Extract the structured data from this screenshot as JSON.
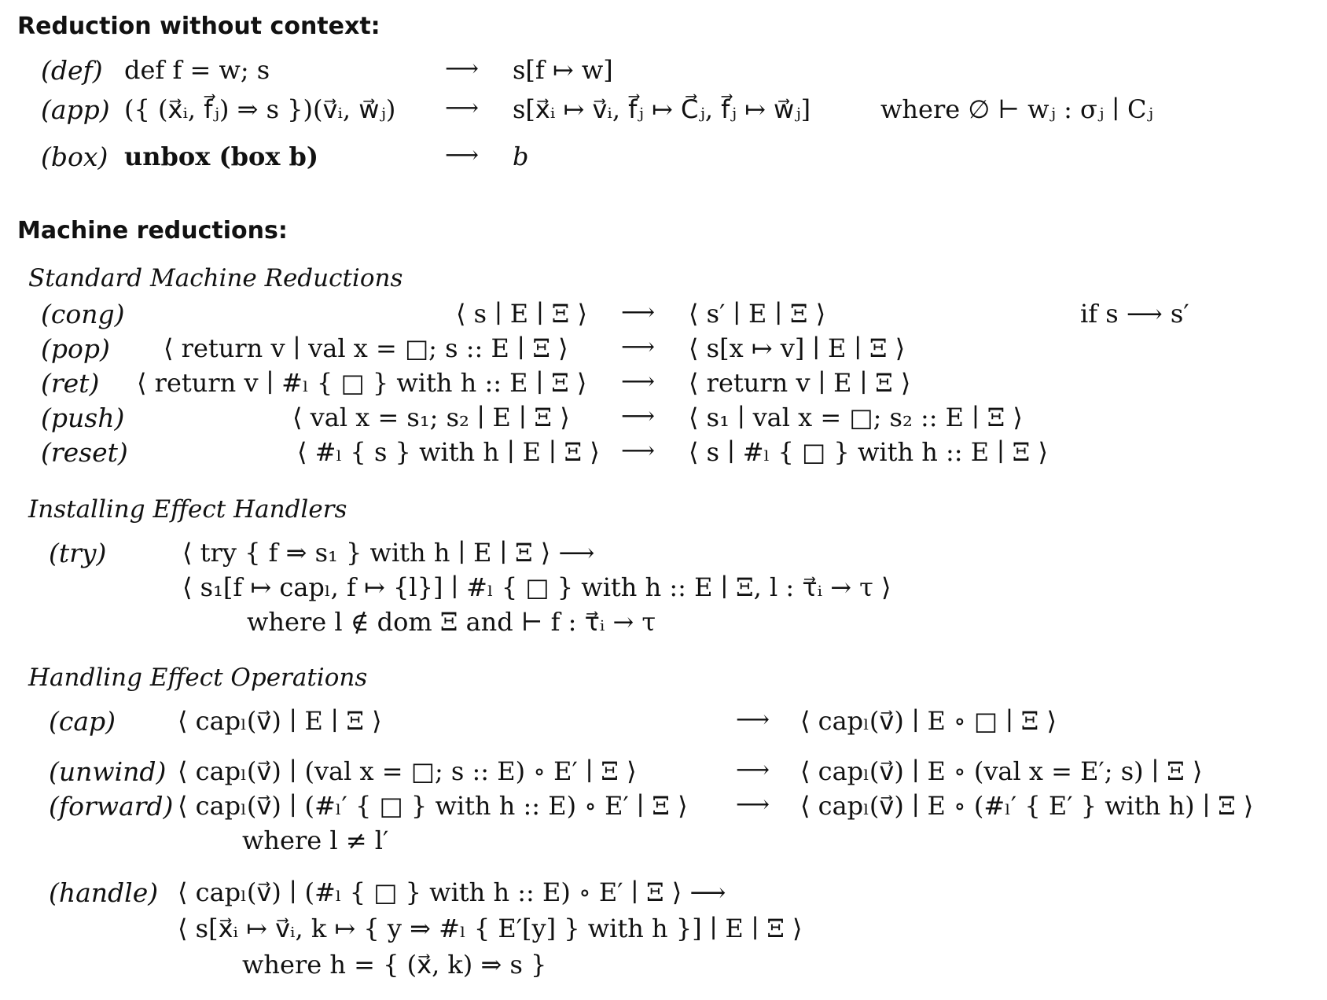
{
  "sections": {
    "without_context": "Reduction without context:",
    "machine": "Machine reductions:",
    "standard": "Standard Machine Reductions",
    "installing": "Installing Effect Handlers",
    "handling": "Handling Effect Operations"
  },
  "ctx_free": [
    {
      "tag": "(def)",
      "lhs": "def f  =  w;  s",
      "arrow": "⟶",
      "rhs": "s[f ↦ w]",
      "side": ""
    },
    {
      "tag": "(app)",
      "lhs": "({ (x⃗ᵢ,  f⃗ⱼ) ⇒ s })(v⃗ᵢ,  w⃗ⱼ)",
      "arrow": "⟶",
      "rhs": "s[x⃗ᵢ ↦ v⃗ᵢ,  f⃗ⱼ ↦ C⃗ⱼ,  f⃗ⱼ ↦ w⃗ⱼ]",
      "side": "where ∅ ⊢  wⱼ  :  σⱼ  ∣  Cⱼ"
    },
    {
      "tag": "(box)",
      "lhs": "unbox (box b)",
      "arrow": "⟶",
      "rhs": "b",
      "side": ""
    }
  ],
  "standard_rules": [
    {
      "tag": "(cong)",
      "lhs": "⟨  s  ∣ E  ∣ Ξ  ⟩",
      "arrow": "⟶",
      "rhs": "⟨  s′  ∣ E  ∣ Ξ  ⟩",
      "side": "if s ⟶ s′"
    },
    {
      "tag": "(pop)",
      "lhs": "⟨  return v  ∣ val x  =  □;  s ::  E  ∣ Ξ  ⟩",
      "arrow": "⟶",
      "rhs": "⟨  s[x ↦ v]  ∣ E  ∣ Ξ  ⟩",
      "side": ""
    },
    {
      "tag": "(ret)",
      "lhs": "⟨  return v  ∣  #ₗ { □ } with h ::  E  ∣ Ξ  ⟩",
      "arrow": "⟶",
      "rhs": "⟨  return v  ∣ E  ∣ Ξ  ⟩",
      "side": ""
    },
    {
      "tag": "(push)",
      "lhs": "⟨  val x  =  s₁;  s₂  ∣ E  ∣ Ξ  ⟩",
      "arrow": "⟶",
      "rhs": "⟨  s₁  ∣ val x  =  □;  s₂ ::  E  ∣ Ξ  ⟩",
      "side": ""
    },
    {
      "tag": "(reset)",
      "lhs": "⟨  #ₗ { s } with h  ∣ E  ∣ Ξ  ⟩",
      "arrow": "⟶",
      "rhs": "⟨  s  ∣  #ₗ { □ } with h ::  E  ∣ Ξ  ⟩",
      "side": ""
    }
  ],
  "try_rule": {
    "tag": "(try)",
    "line1": "⟨  try { f ⇒ s₁ } with h  ∣ E  ∣ Ξ  ⟩  ⟶",
    "line2": "⟨  s₁[f ↦ capₗ,  f ↦ {l}]  ∣  #ₗ { □ } with h ::  E  ∣ Ξ,  l  :  τ⃗ᵢ → τ  ⟩",
    "where": "where l  ∉  dom Ξ      and      ⊢  f   :  τ⃗ᵢ → τ"
  },
  "handling_rules": [
    {
      "tag": "(cap)",
      "lhs": "⟨  capₗ(v⃗)  ∣ E  ∣ Ξ  ⟩",
      "arrow": "⟶",
      "rhs": "⟨  capₗ(v⃗)  ∣ E  ∘ □ ∣ Ξ  ⟩"
    },
    {
      "tag": "(unwind)",
      "lhs": "⟨  capₗ(v⃗)  ∣ (val x  =  □;  s ::  E)  ∘ E′  ∣ Ξ  ⟩",
      "arrow": "⟶",
      "rhs": "⟨  capₗ(v⃗)  ∣ E  ∘ (val x  =  E′;  s)  ∣ Ξ  ⟩"
    },
    {
      "tag": "(forward)",
      "lhs": "⟨  capₗ(v⃗)  ∣ (#ₗ′ { □ } with h ::  E)  ∘ E′  ∣ Ξ  ⟩",
      "arrow": "⟶",
      "rhs": "⟨  capₗ(v⃗)  ∣ E  ∘ (#ₗ′ { E′ } with h)  ∣ Ξ  ⟩"
    }
  ],
  "forward_where": "where l ≠ l′",
  "handle_rule": {
    "tag": "(handle)",
    "line1": "⟨  capₗ(v⃗)  ∣ (#ₗ { □ } with h ::  E)  ∘ E′  ∣ Ξ  ⟩   ⟶",
    "line2": "⟨  s[x⃗ᵢ ↦ v⃗ᵢ,  k ↦ { y ⇒ #ₗ { E′[y] } with h }]  ∣ E  ∣ Ξ  ⟩",
    "where": "where h  =  { (x⃗,  k) ⇒ s }"
  }
}
